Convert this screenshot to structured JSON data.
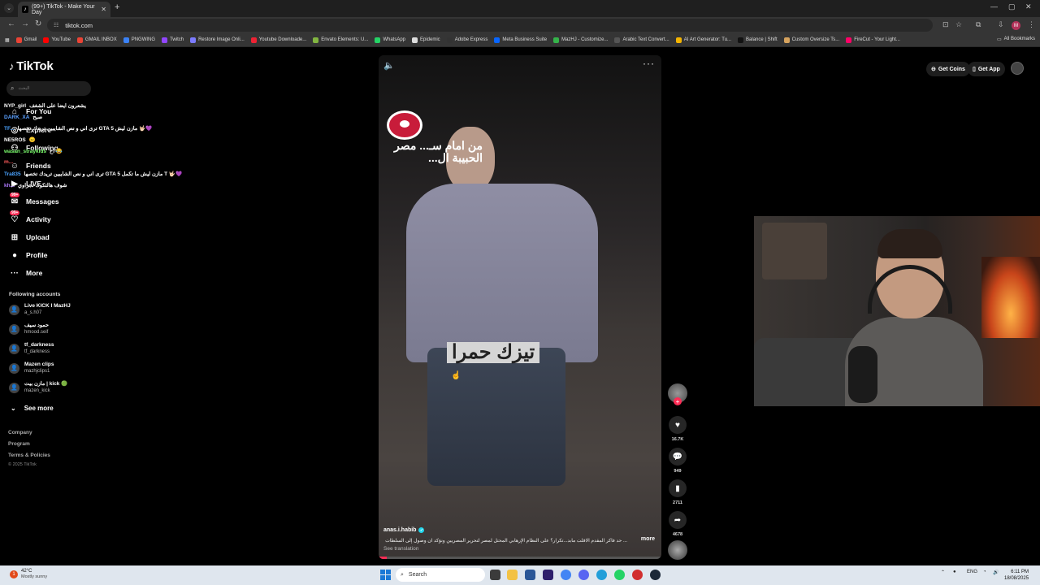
{
  "browser": {
    "tab_title": "(99+) TikTok - Make Your Day",
    "url": "tiktok.com",
    "bookmarks": [
      {
        "label": "Gmail",
        "color": "#ea4335"
      },
      {
        "label": "YouTube",
        "color": "#ff0000"
      },
      {
        "label": "GMAIL INBOX",
        "color": "#ea4335"
      },
      {
        "label": "PNGWING",
        "color": "#3b82f6"
      },
      {
        "label": "Twitch",
        "color": "#9146ff"
      },
      {
        "label": "Restore Image Onli...",
        "color": "#7c7cff"
      },
      {
        "label": "Youtube Downloade...",
        "color": "#e23"
      },
      {
        "label": "Envato Elements: U...",
        "color": "#82b541"
      },
      {
        "label": "WhatsApp",
        "color": "#25d366"
      },
      {
        "label": "Epidemic",
        "color": "#ddd"
      },
      {
        "label": "Adobe Express",
        "color": "#333"
      },
      {
        "label": "Meta Business Suite",
        "color": "#0866ff"
      },
      {
        "label": "MazHJ - Customize...",
        "color": "#35b34a"
      },
      {
        "label": "Arabic Text Convert...",
        "color": "#555"
      },
      {
        "label": "AI Art Generator: Tu...",
        "color": "#f4b400"
      },
      {
        "label": "Balance | Shift",
        "color": "#111"
      },
      {
        "label": "Custom Oversize Ts...",
        "color": "#d6a35e"
      },
      {
        "label": "FireCut - Your Light...",
        "color": "#f06"
      }
    ],
    "all_bookmarks": "All Bookmarks"
  },
  "tiktok": {
    "logo": "TikTok",
    "search_placeholder": "البحث",
    "nav": [
      {
        "label": "For You",
        "icon": "home-icon"
      },
      {
        "label": "Explore",
        "icon": "compass-icon"
      },
      {
        "label": "Following",
        "icon": "people-icon"
      },
      {
        "label": "Friends",
        "icon": "friends-icon"
      },
      {
        "label": "LIVE",
        "icon": "live-icon"
      },
      {
        "label": "Messages",
        "icon": "message-icon",
        "badge": "99+"
      },
      {
        "label": "Activity",
        "icon": "activity-icon",
        "badge": "99+"
      },
      {
        "label": "Upload",
        "icon": "upload-icon"
      },
      {
        "label": "Profile",
        "icon": "profile-icon"
      },
      {
        "label": "More",
        "icon": "more-icon"
      }
    ],
    "chat": [
      {
        "user": "NYP_girl",
        "color": "#ffffff",
        "msg": "يشعرون ايضا على الشغف"
      },
      {
        "user": "DARK_XA",
        "color": "#5aa0ff",
        "msg": "صبح"
      },
      {
        "user": "TF...",
        "color": "#4aa3ff",
        "msg": "ترى اني و نص الشايبين تريدك تخصها GTA 5 مازن ليش 🤟🏻💜"
      },
      {
        "user": "NE5ROS",
        "color": "#ffffff",
        "msg": "😑"
      },
      {
        "user": "wasan_straykids",
        "color": "#7cff6e",
        "msg": "اخ 😂"
      },
      {
        "user": "m...",
        "color": "#ff5a5a",
        "msg": ""
      },
      {
        "user": "Tra835",
        "color": "#4aa3ff",
        "msg": "ترى اني و نص الشايبين تريدك تخصها GTA 5 مازن ليش ما تكمل T 🤟🏻💜"
      },
      {
        "user": "kh...",
        "color": "#b07aff",
        "msg": "شوف هالتكوك تجزاوي"
      }
    ],
    "following_title": "Following accounts",
    "following": [
      {
        "name": "Live KICK I MazHJ",
        "handle": "a_s.h07"
      },
      {
        "name": "حمود سيف",
        "handle": "hmood.seif"
      },
      {
        "name": "tf_darkness",
        "handle": "tf_darkness"
      },
      {
        "name": "Mazen clips",
        "handle": "mazhjclips1"
      },
      {
        "name": "مازن بيت | kick 🟢",
        "handle": "mazen_kick"
      }
    ],
    "see_more": "See more",
    "footer": [
      "Company",
      "Program",
      "Terms & Policies"
    ],
    "copyright": "© 2025 TikTok",
    "get_coins": "Get Coins",
    "get_app": "Get App",
    "video": {
      "overlay_text": "من امام سـ... مصر الحبيبة ال...",
      "caption": "تيزك حمرا",
      "author": "anas.i.habib",
      "description": "... حد فاكر المقدم الاقلت مابد...تكرار؟ على النظام الإرهابي المحتل لمصر لتحرير المصريين ونؤكد ان وصول إلى السلطات",
      "more": "more",
      "see_translation": "See translation",
      "progress": 0.03
    },
    "actions": {
      "likes": "16.7K",
      "comments": "949",
      "saves": "2711",
      "shares": "4678"
    }
  },
  "taskbar": {
    "temp": "42°C",
    "weather": "Mostly sunny",
    "search": "Search",
    "lang": "ENG",
    "time": "6:11 PM",
    "date": "18/08/2025"
  }
}
